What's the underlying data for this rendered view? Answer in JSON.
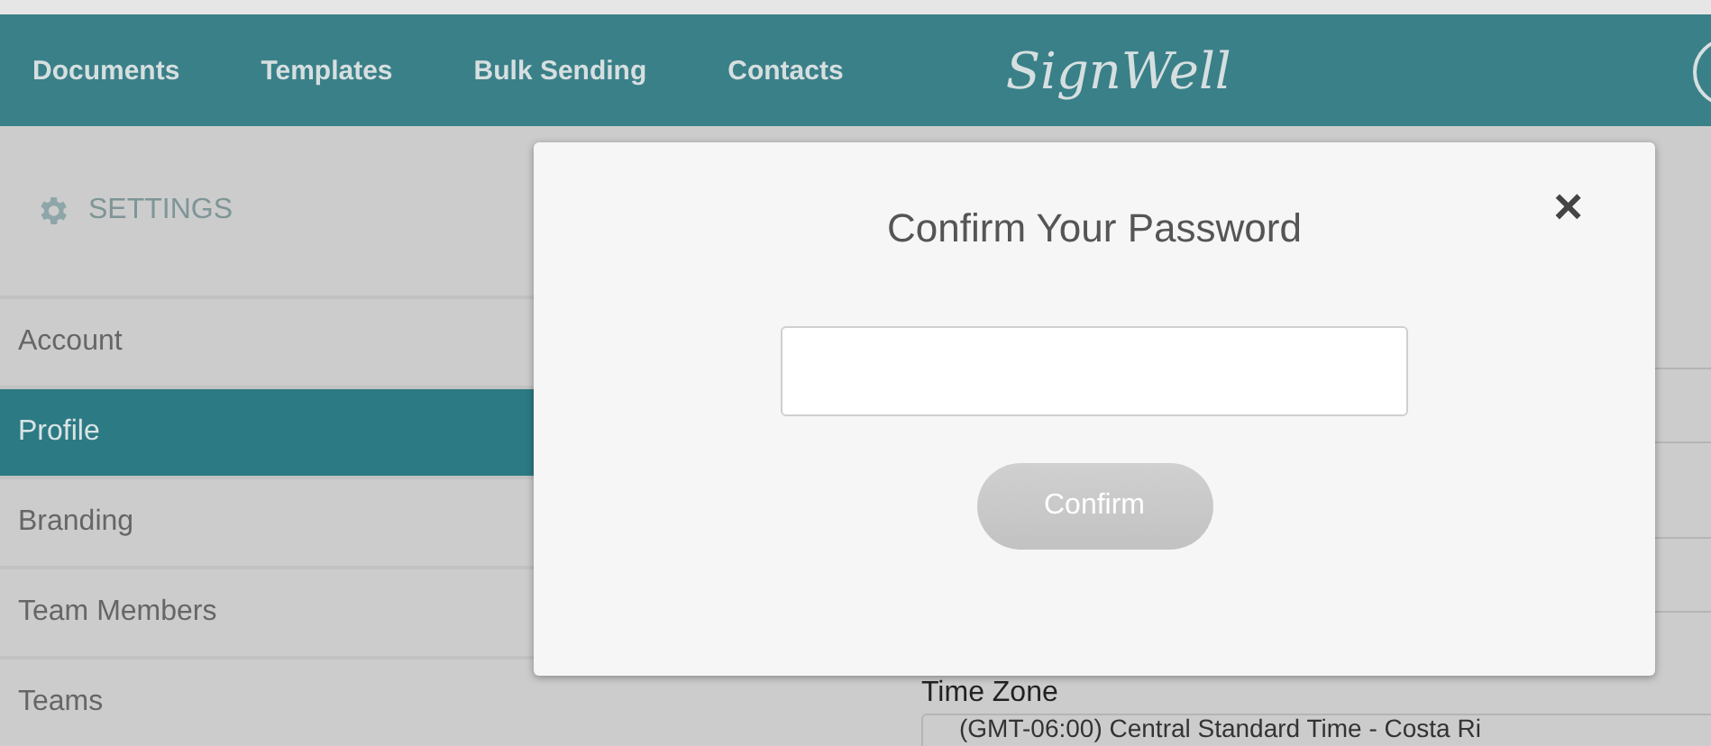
{
  "nav": {
    "items": [
      {
        "label": "Documents"
      },
      {
        "label": "Templates"
      },
      {
        "label": "Bulk Sending"
      },
      {
        "label": "Contacts"
      }
    ],
    "logo": "SignWell"
  },
  "sidebar": {
    "heading": "SETTINGS",
    "items": [
      {
        "label": "Account",
        "selected": false
      },
      {
        "label": "Profile",
        "selected": true
      },
      {
        "label": "Branding",
        "selected": false
      },
      {
        "label": "Team Members",
        "selected": false
      },
      {
        "label": "Teams",
        "selected": false
      }
    ]
  },
  "form": {
    "time_zone_label": "Time Zone",
    "time_zone_value": "(GMT-06:00) Central Standard Time - Costa Ri"
  },
  "dialog": {
    "title": "Confirm Your Password",
    "close": "×",
    "button": {
      "label": "Confirm",
      "disabled": true
    }
  }
}
